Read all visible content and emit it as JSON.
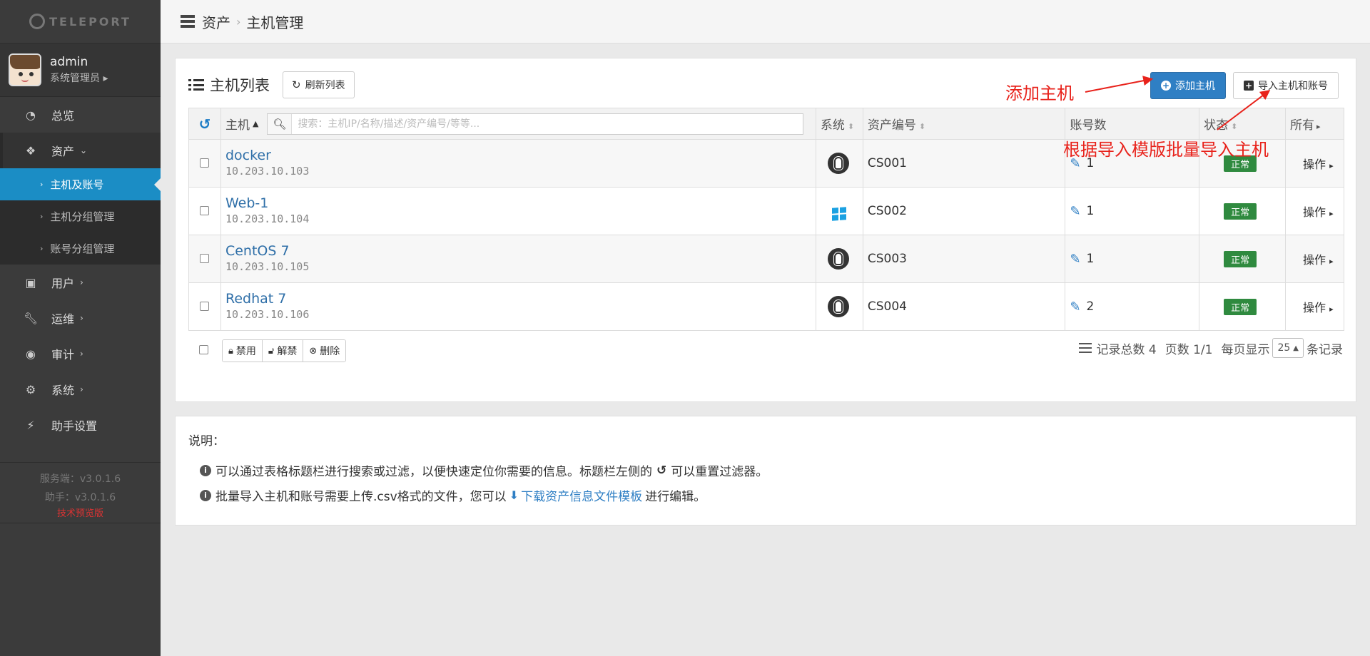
{
  "app": {
    "logo_text": "TELEPORT"
  },
  "user": {
    "name": "admin",
    "role": "系统管理员 ▸"
  },
  "sidebar": {
    "items": [
      {
        "label": "总览",
        "icon": "dashboard-icon"
      },
      {
        "label": "资产",
        "icon": "cubes-icon"
      },
      {
        "label": "用户",
        "icon": "user-card-icon"
      },
      {
        "label": "运维",
        "icon": "wrench-icon"
      },
      {
        "label": "审计",
        "icon": "eye-icon"
      },
      {
        "label": "系统",
        "icon": "gear-icon"
      },
      {
        "label": "助手设置",
        "icon": "bolt-icon"
      }
    ],
    "sub_items": [
      "主机及账号",
      "主机分组管理",
      "账号分组管理"
    ],
    "server_version": "服务端：v3.0.1.6",
    "assist_version": "助手：v3.0.1.6",
    "preview_label": "技术预览版"
  },
  "breadcrumb": {
    "root": "资产",
    "current": "主机管理"
  },
  "panel": {
    "title": "主机列表",
    "refresh_label": "刷新列表",
    "add_host_label": "添加主机",
    "import_label": "导入主机和账号"
  },
  "table": {
    "headers": {
      "host": "主机",
      "system": "系统",
      "asset_no": "资产编号",
      "accounts": "账号数",
      "status": "状态",
      "filter_all": "所有"
    },
    "search_placeholder": "搜索：主机IP/名称/描述/资产编号/等等...",
    "rows": [
      {
        "name": "docker",
        "ip": "10.203.10.103",
        "os": "linux",
        "asset_no": "CS001",
        "accounts": "1",
        "status": "正常",
        "action": "操作"
      },
      {
        "name": "Web-1",
        "ip": "10.203.10.104",
        "os": "windows",
        "asset_no": "CS002",
        "accounts": "1",
        "status": "正常",
        "action": "操作"
      },
      {
        "name": "CentOS 7",
        "ip": "10.203.10.105",
        "os": "linux",
        "asset_no": "CS003",
        "accounts": "1",
        "status": "正常",
        "action": "操作"
      },
      {
        "name": "Redhat 7",
        "ip": "10.203.10.106",
        "os": "linux",
        "asset_no": "CS004",
        "accounts": "2",
        "status": "正常",
        "action": "操作"
      }
    ]
  },
  "bulk_actions": {
    "disable": "禁用",
    "enable": "解禁",
    "delete": "删除"
  },
  "pager": {
    "total": "记录总数 4",
    "pages": "页数 1/1",
    "per_page_label": "每页显示",
    "per_page_value": "25",
    "records_suffix": "条记录"
  },
  "notes": {
    "title": "说明：",
    "line1_a": "可以通过表格标题栏进行搜索或过滤，以便快速定位你需要的信息。标题栏左侧的",
    "line1_b": "可以重置过滤器。",
    "line2_a": "批量导入主机和账号需要上传.csv格式的文件，您可以",
    "line2_link": "下载资产信息文件模板",
    "line2_b": "进行编辑。"
  },
  "annotations": {
    "add_host": "添加主机",
    "import_hint": "根据导入模版批量导入主机",
    "color": "#e8221b"
  },
  "colors": {
    "accent": "#1b8dc5",
    "primary_button": "#2f7fc4",
    "status_ok": "#2f8a3f",
    "sidebar_bg": "#3b3b3b"
  }
}
